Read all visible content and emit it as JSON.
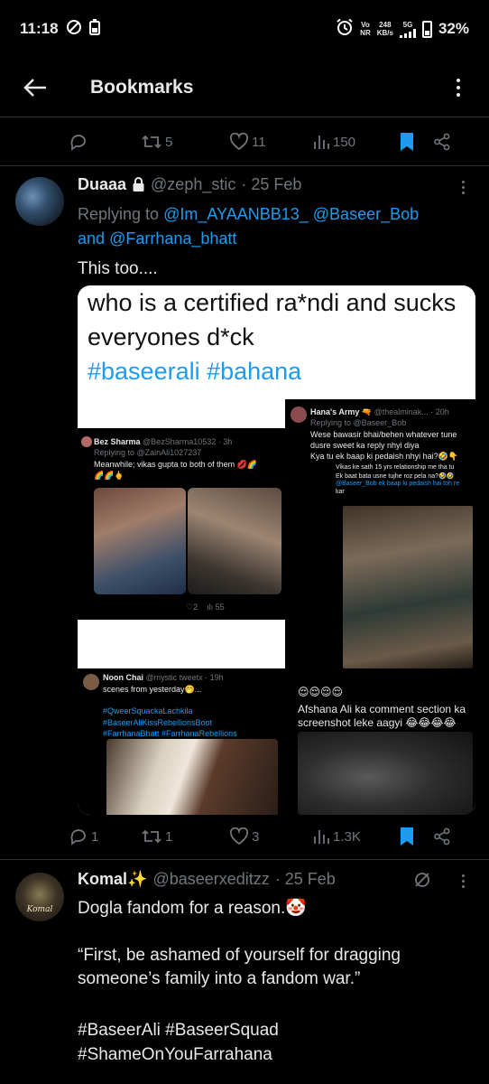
{
  "status_bar": {
    "time": "11:18",
    "net_top": "Vo",
    "net_bottom": "NR",
    "speed_top": "248",
    "speed_bottom": "KB/s",
    "network": "5G",
    "battery": "32%"
  },
  "header": {
    "title": "Bookmarks"
  },
  "top_actions": {
    "retweets": "5",
    "likes": "11",
    "views": "150"
  },
  "tweet1": {
    "display_name": "Duaaa",
    "handle": "@zeph_stic",
    "date": "· 25 Feb",
    "replying_prefix": "Replying to",
    "reply_user_1": "@Im_AYAANBB13_",
    "reply_user_2": "@Baseer_Bob",
    "reply_and": "and",
    "reply_user_3": "@Farrhana_bhatt",
    "text": "This too....",
    "image": {
      "headline_line1": "who is a certified ra*ndi and sucks",
      "headline_line2": "everyones d*ck",
      "headline_tags": "#baseerali #bahana",
      "panel_bez": {
        "name": "Bez Sharma",
        "handle": "@BezSharma10532 · 3h",
        "replying": "Replying to @ZainAli1027237",
        "text": "Meanwhile; vikas gupta to both of them 💋🌈",
        "emojis": "🌈🌈🖕",
        "likes": "2",
        "views": "55"
      },
      "panel_hana": {
        "name": "Hana's Army 🔫",
        "handle": "@thealminak... · 20h",
        "replying": "Replying to @Baseer_Bob",
        "line1": "Wese bawasir bhai/behen whatever tune",
        "line2": "dusre sweet ka reply nhyi diya",
        "line3": "Kya tu ek baap ki pedaish nhyi hai?🤣👇",
        "line4": "Vikas ke sath 15 yrs relationship me tha tu",
        "line5": "Ek baat bata usne tujhe roz pela na?🤣🤣",
        "line6": "@Baseer_Bob ek baap ki pedaish hai toh re",
        "line7": "kar"
      },
      "panel_noon": {
        "name": "Noon Chai",
        "handle": "@mystic tweetx · 19h",
        "text": "scenes from yesterday🤭...",
        "tags1": "#QweerSquackaLachkila",
        "tags2": "#BaseerAliKissRebellionsBoot",
        "tags3": "#FarrhanaBhatt #FarrhanaRebellions"
      },
      "panel_afshana": {
        "emojis": "😌😌😌😌",
        "line1": "Afshana Ali ka comment section ka",
        "line2": "screenshot leke aagyi 😂😂😂😂"
      }
    },
    "replies": "1",
    "retweets": "1",
    "likes": "3",
    "views": "1.3K"
  },
  "tweet2": {
    "display_name": "Komal✨",
    "handle": "@baseerxeditzz",
    "date": "· 25 Feb",
    "line1": "Dogla fandom for a reason.🤡",
    "line2": "“First, be ashamed of yourself for dragging",
    "line3": "someone’s family into a fandom war.”",
    "hashtags1": "#BaseerAli #BaseerSquad",
    "hashtags2": "#ShameOnYouFarrahana",
    "avatar_text": "Komal"
  },
  "colors": {
    "accent": "#1d9bf0",
    "muted": "#71767b",
    "background": "#000000",
    "divider": "#2f3336"
  }
}
